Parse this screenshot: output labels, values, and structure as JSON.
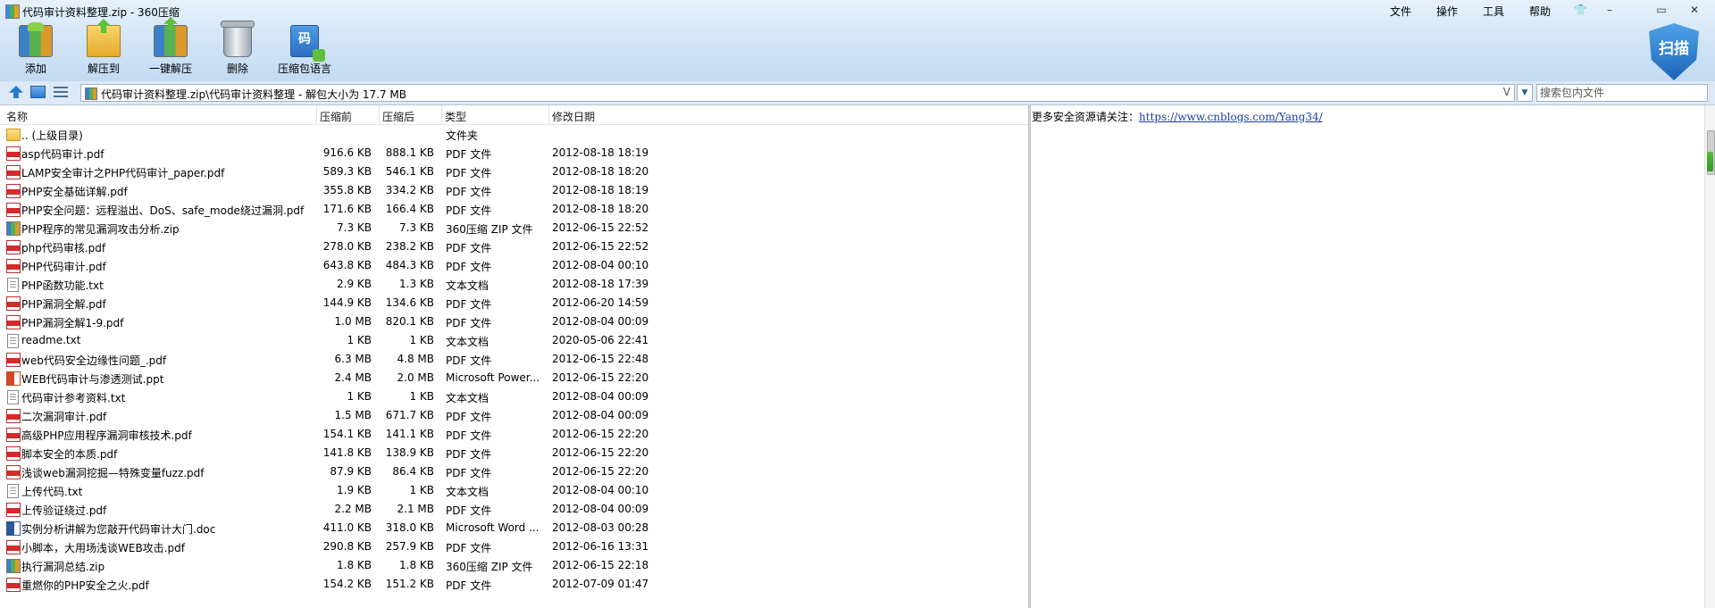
{
  "window": {
    "title": "代码审计资料整理.zip - 360压缩"
  },
  "menu": [
    "文件",
    "操作",
    "工具",
    "帮助"
  ],
  "toolbar": {
    "add": "添加",
    "extract_to": "解压到",
    "one_click_extract": "一键解压",
    "delete": "删除",
    "archive_language": "压缩包语言",
    "lang_glyph": "码"
  },
  "scan": {
    "label": "扫描"
  },
  "address": {
    "path": "代码审计资料整理.zip\\代码审计资料整理 - 解包大小为 17.7 MB",
    "v_mark": "V"
  },
  "search": {
    "placeholder": "搜索包内文件"
  },
  "columns": {
    "name": "名称",
    "before": "压缩前",
    "after": "压缩后",
    "type": "类型",
    "date": "修改日期"
  },
  "files": [
    {
      "icon": "folder",
      "name": ".. (上级目录)",
      "before": "",
      "after": "",
      "type": "文件夹",
      "date": ""
    },
    {
      "icon": "pdf",
      "name": "asp代码审计.pdf",
      "before": "916.6 KB",
      "after": "888.1 KB",
      "type": "PDF 文件",
      "date": "2012-08-18 18:19"
    },
    {
      "icon": "pdf",
      "name": "LAMP安全审计之PHP代码审计_paper.pdf",
      "before": "589.3 KB",
      "after": "546.1 KB",
      "type": "PDF 文件",
      "date": "2012-08-18 18:20"
    },
    {
      "icon": "pdf",
      "name": "PHP安全基础详解.pdf",
      "before": "355.8 KB",
      "after": "334.2 KB",
      "type": "PDF 文件",
      "date": "2012-08-18 18:19"
    },
    {
      "icon": "pdf",
      "name": "PHP安全问题：远程溢出、DoS、safe_mode绕过漏洞.pdf",
      "before": "171.6 KB",
      "after": "166.4 KB",
      "type": "PDF 文件",
      "date": "2012-08-18 18:20"
    },
    {
      "icon": "zip",
      "name": "PHP程序的常见漏洞攻击分析.zip",
      "before": "7.3 KB",
      "after": "7.3 KB",
      "type": "360压缩 ZIP 文件",
      "date": "2012-06-15 22:52"
    },
    {
      "icon": "pdf",
      "name": "php代码审核.pdf",
      "before": "278.0 KB",
      "after": "238.2 KB",
      "type": "PDF 文件",
      "date": "2012-06-15 22:52"
    },
    {
      "icon": "pdf",
      "name": "PHP代码审计.pdf",
      "before": "643.8 KB",
      "after": "484.3 KB",
      "type": "PDF 文件",
      "date": "2012-08-04 00:10"
    },
    {
      "icon": "txt",
      "name": "PHP函数功能.txt",
      "before": "2.9 KB",
      "after": "1.3 KB",
      "type": "文本文档",
      "date": "2012-08-18 17:39"
    },
    {
      "icon": "pdf",
      "name": "PHP漏洞全解.pdf",
      "before": "144.9 KB",
      "after": "134.6 KB",
      "type": "PDF 文件",
      "date": "2012-06-20 14:59"
    },
    {
      "icon": "pdf",
      "name": "PHP漏洞全解1-9.pdf",
      "before": "1.0 MB",
      "after": "820.1 KB",
      "type": "PDF 文件",
      "date": "2012-08-04 00:09"
    },
    {
      "icon": "txt",
      "name": "readme.txt",
      "before": "1 KB",
      "after": "1 KB",
      "type": "文本文档",
      "date": "2020-05-06 22:41"
    },
    {
      "icon": "pdf",
      "name": "web代码安全边缘性问题_.pdf",
      "before": "6.3 MB",
      "after": "4.8 MB",
      "type": "PDF 文件",
      "date": "2012-06-15 22:48"
    },
    {
      "icon": "ppt",
      "name": "WEB代码审计与渗透测试.ppt",
      "before": "2.4 MB",
      "after": "2.0 MB",
      "type": "Microsoft Power...",
      "date": "2012-06-15 22:20"
    },
    {
      "icon": "txt",
      "name": "代码审计参考资料.txt",
      "before": "1 KB",
      "after": "1 KB",
      "type": "文本文档",
      "date": "2012-08-04 00:09"
    },
    {
      "icon": "pdf",
      "name": "二次漏洞审计.pdf",
      "before": "1.5 MB",
      "after": "671.7 KB",
      "type": "PDF 文件",
      "date": "2012-08-04 00:09"
    },
    {
      "icon": "pdf",
      "name": "高级PHP应用程序漏洞审核技术.pdf",
      "before": "154.1 KB",
      "after": "141.1 KB",
      "type": "PDF 文件",
      "date": "2012-06-15 22:20"
    },
    {
      "icon": "pdf",
      "name": "脚本安全的本质.pdf",
      "before": "141.8 KB",
      "after": "138.9 KB",
      "type": "PDF 文件",
      "date": "2012-06-15 22:20"
    },
    {
      "icon": "pdf",
      "name": "浅谈web漏洞挖掘—特殊变量fuzz.pdf",
      "before": "87.9 KB",
      "after": "86.4 KB",
      "type": "PDF 文件",
      "date": "2012-06-15 22:20"
    },
    {
      "icon": "txt",
      "name": "上传代码.txt",
      "before": "1.9 KB",
      "after": "1 KB",
      "type": "文本文档",
      "date": "2012-08-04 00:10"
    },
    {
      "icon": "pdf",
      "name": "上传验证绕过.pdf",
      "before": "2.2 MB",
      "after": "2.1 MB",
      "type": "PDF 文件",
      "date": "2012-08-04 00:09"
    },
    {
      "icon": "doc",
      "name": "实例分析讲解为您敲开代码审计大门.doc",
      "before": "411.0 KB",
      "after": "318.0 KB",
      "type": "Microsoft Word ...",
      "date": "2012-08-03 00:28"
    },
    {
      "icon": "pdf",
      "name": "小脚本，大用场浅谈WEB攻击.pdf",
      "before": "290.8 KB",
      "after": "257.9 KB",
      "type": "PDF 文件",
      "date": "2012-06-16 13:31"
    },
    {
      "icon": "zip",
      "name": "执行漏洞总结.zip",
      "before": "1.8 KB",
      "after": "1.8 KB",
      "type": "360压缩 ZIP 文件",
      "date": "2012-06-15 22:18"
    },
    {
      "icon": "pdf",
      "name": "重燃你的PHP安全之火.pdf",
      "before": "154.2 KB",
      "after": "151.2 KB",
      "type": "PDF 文件",
      "date": "2012-07-09 01:47"
    }
  ],
  "comment": {
    "prefix": "更多安全资源请关注：",
    "link": "https://www.cnblogs.com/Yang34/"
  },
  "window_controls": {
    "skin": "👕",
    "minimize": "–",
    "restore": "▭",
    "close": "✕"
  }
}
